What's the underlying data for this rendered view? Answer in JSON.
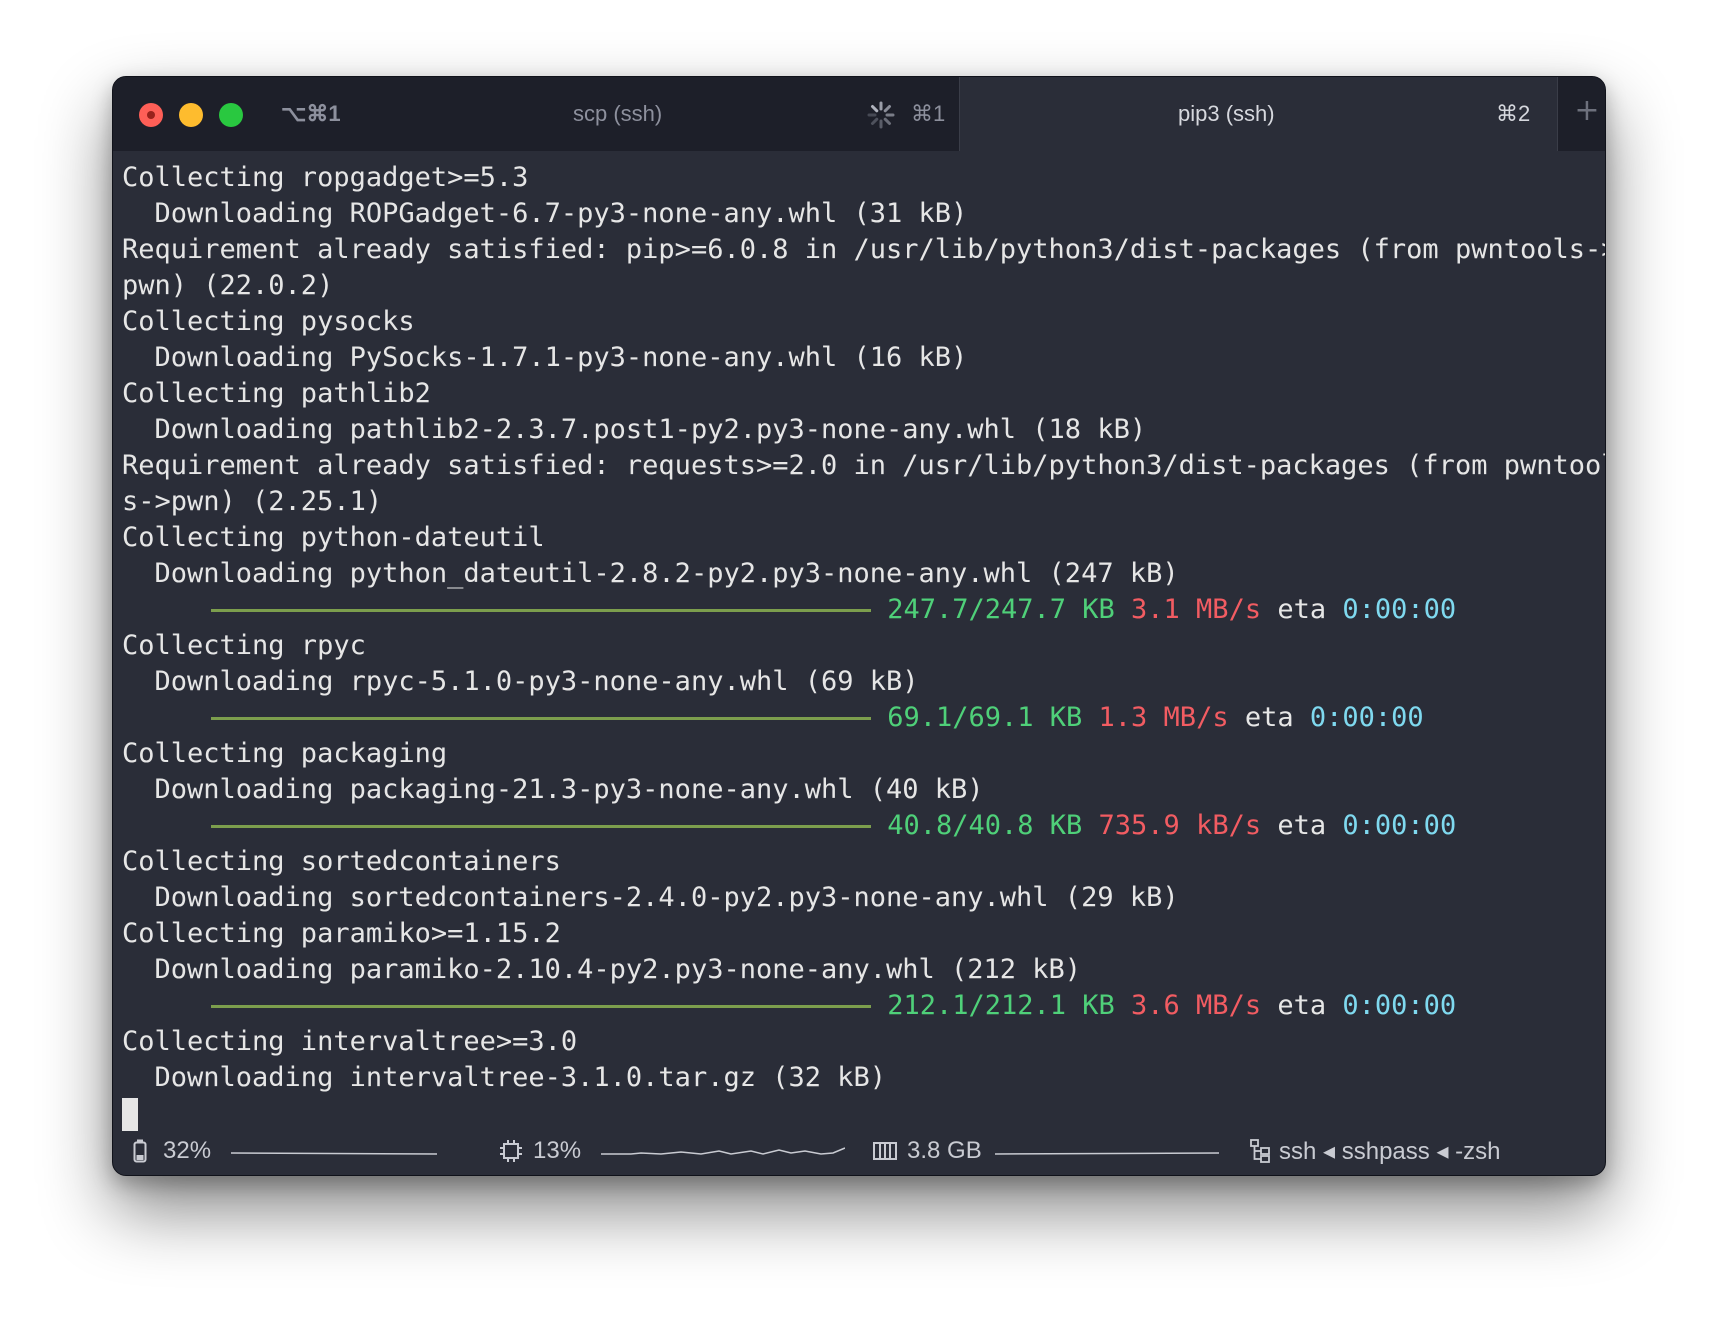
{
  "window": {
    "tabs": [
      {
        "shortcut_left": "⌥⌘1",
        "title": "scp (ssh)",
        "shortcut_right": "⌘1",
        "active": false
      },
      {
        "title": "pip3 (ssh)",
        "shortcut_right": "⌘2",
        "active": true
      }
    ],
    "new_tab_label": "+"
  },
  "terminal": {
    "lines": [
      {
        "text": "Collecting ropgadget>=5.3"
      },
      {
        "text": "  Downloading ROPGadget-6.7-py3-none-any.whl (31 kB)"
      },
      {
        "text": "Requirement already satisfied: pip>=6.0.8 in /usr/lib/python3/dist-packages (from pwntools->"
      },
      {
        "text": "pwn) (22.0.2)"
      },
      {
        "text": "Collecting pysocks"
      },
      {
        "text": "  Downloading PySocks-1.7.1-py3-none-any.whl (16 kB)"
      },
      {
        "text": "Collecting pathlib2"
      },
      {
        "text": "  Downloading pathlib2-2.3.7.post1-py2.py3-none-any.whl (18 kB)"
      },
      {
        "text": "Requirement already satisfied: requests>=2.0 in /usr/lib/python3/dist-packages (from pwntool"
      },
      {
        "text": "s->pwn) (2.25.1)"
      },
      {
        "text": "Collecting python-dateutil"
      },
      {
        "text": "  Downloading python_dateutil-2.8.2-py2.py3-none-any.whl (247 kB)"
      },
      {
        "progress": {
          "amount": "247.7/247.7 KB",
          "speed": "3.1 MB/s",
          "eta_label": "eta",
          "eta": "0:00:00",
          "fraction": 1.0
        }
      },
      {
        "text": "Collecting rpyc"
      },
      {
        "text": "  Downloading rpyc-5.1.0-py3-none-any.whl (69 kB)"
      },
      {
        "progress": {
          "amount": "69.1/69.1 KB",
          "speed": "1.3 MB/s",
          "eta_label": "eta",
          "eta": "0:00:00",
          "fraction": 1.0
        }
      },
      {
        "text": "Collecting packaging"
      },
      {
        "text": "  Downloading packaging-21.3-py3-none-any.whl (40 kB)"
      },
      {
        "progress": {
          "amount": "40.8/40.8 KB",
          "speed": "735.9 kB/s",
          "eta_label": "eta",
          "eta": "0:00:00",
          "fraction": 1.0
        }
      },
      {
        "text": "Collecting sortedcontainers"
      },
      {
        "text": "  Downloading sortedcontainers-2.4.0-py2.py3-none-any.whl (29 kB)"
      },
      {
        "text": "Collecting paramiko>=1.15.2"
      },
      {
        "text": "  Downloading paramiko-2.10.4-py2.py3-none-any.whl (212 kB)"
      },
      {
        "progress": {
          "amount": "212.1/212.1 KB",
          "speed": "3.6 MB/s",
          "eta_label": "eta",
          "eta": "0:00:00",
          "fraction": 1.0
        }
      },
      {
        "text": "Collecting intervaltree>=3.0"
      },
      {
        "text": "  Downloading intervaltree-3.1.0.tar.gz (32 kB)"
      },
      {
        "cursor": true
      }
    ]
  },
  "statusbar": {
    "battery": {
      "icon": "battery-icon",
      "value": "32%"
    },
    "cpu": {
      "icon": "cpu-icon",
      "value": "13%"
    },
    "memory": {
      "icon": "memory-icon",
      "value": "3.8 GB"
    },
    "jobs": {
      "icon": "process-tree-icon",
      "value": "ssh ◂ sshpass ◂ -zsh"
    }
  },
  "colors": {
    "background": "#2a2d38",
    "titlebar": "#1d1f29",
    "progress_bar": "#7c9e4d",
    "amount": "#4fd079",
    "speed": "#f25c62",
    "eta": "#7fd9ef"
  }
}
